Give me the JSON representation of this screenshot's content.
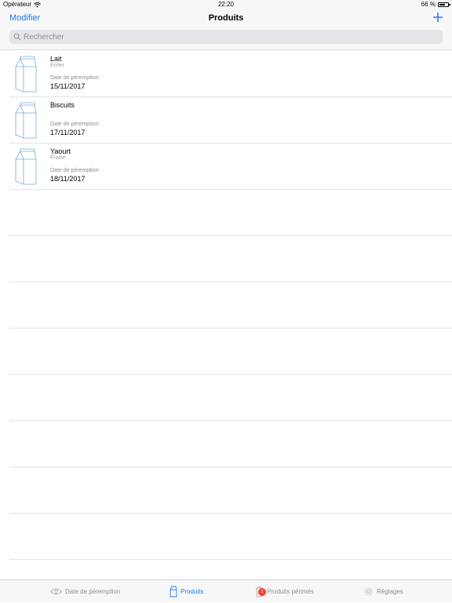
{
  "status_bar": {
    "carrier": "Opérateur",
    "time": "22:20",
    "battery": "66 %"
  },
  "nav": {
    "edit_label": "Modifier",
    "title": "Produits"
  },
  "search": {
    "placeholder": "Rechercher"
  },
  "products": [
    {
      "name": "Lait",
      "variant": "Entier",
      "date_label": "Date de péremption:",
      "date": "15/11/2017"
    },
    {
      "name": "Biscuits",
      "variant": "",
      "date_label": "Date de péremption:",
      "date": "17/11/2017"
    },
    {
      "name": "Yaourt",
      "variant": "Fraise",
      "date_label": "Date de péremption:",
      "date": "18/11/2017"
    }
  ],
  "tabs": [
    {
      "label": "Date de péremption",
      "icon": "eye-icon"
    },
    {
      "label": "Produits",
      "icon": "milk-carton-icon"
    },
    {
      "label": "Produits périmés",
      "icon": "trash-icon",
      "badge": "1"
    },
    {
      "label": "Réglages",
      "icon": "gear-icon"
    }
  ],
  "colors": {
    "accent": "#1a7cf0",
    "badge": "#ff3b30"
  }
}
